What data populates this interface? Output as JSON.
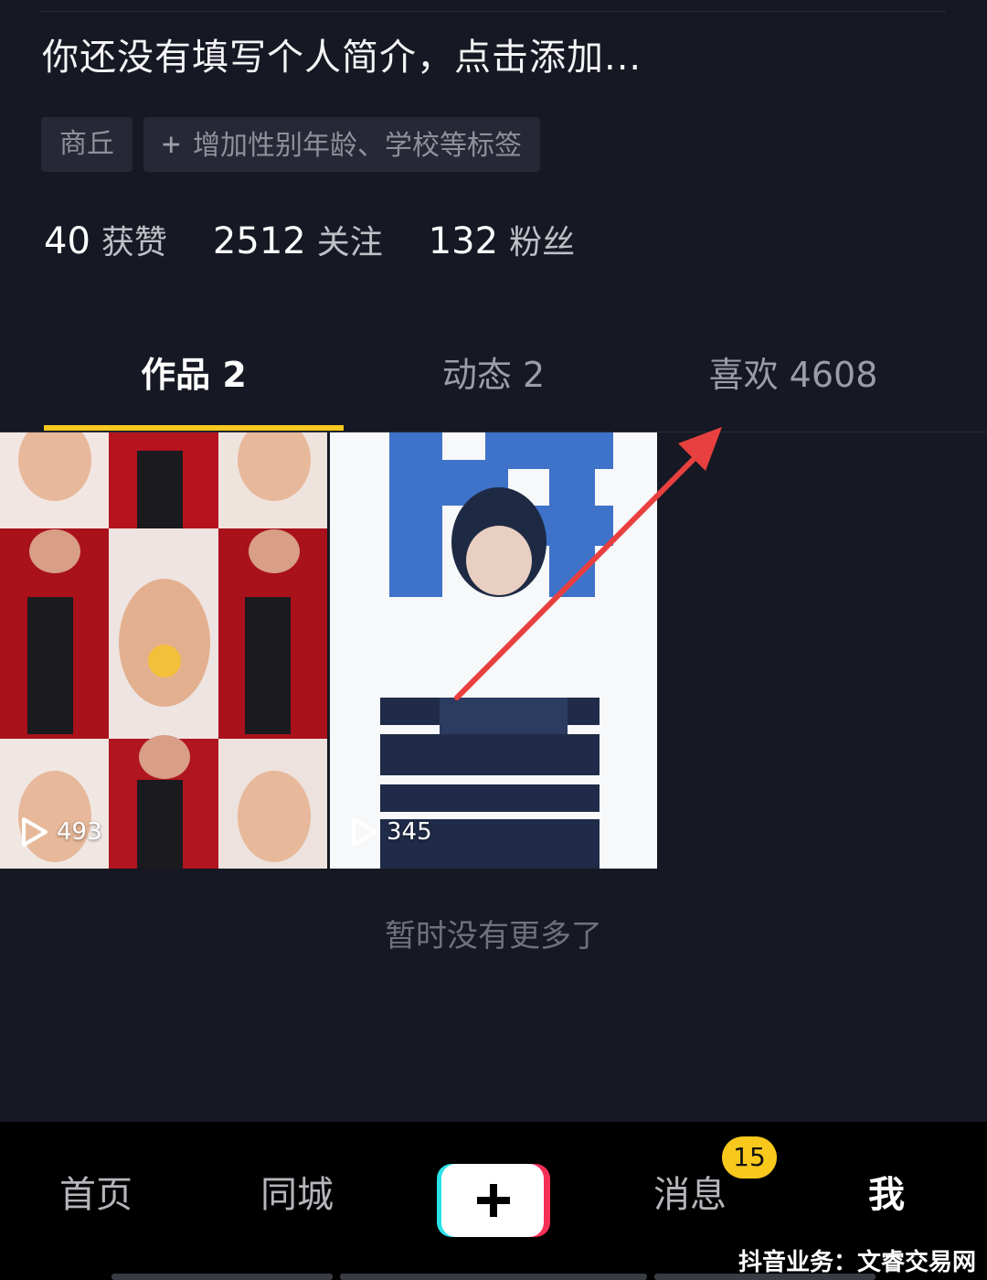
{
  "profile": {
    "bio": "你还没有填写个人简介，点击添加...",
    "tags": [
      {
        "label": "商丘"
      },
      {
        "label": "增加性别年龄、学校等标签"
      }
    ],
    "stats": [
      {
        "value": "40",
        "label": "获赞"
      },
      {
        "value": "2512",
        "label": "关注"
      },
      {
        "value": "132",
        "label": "粉丝"
      }
    ]
  },
  "tabs": [
    {
      "label": "作品 2"
    },
    {
      "label": "动态 2"
    },
    {
      "label": "喜欢 4608"
    }
  ],
  "videos": [
    {
      "plays": "493"
    },
    {
      "plays": "345"
    }
  ],
  "empty_text": "暂时没有更多了",
  "bottom_nav": {
    "items": [
      {
        "label": "首页"
      },
      {
        "label": "同城"
      },
      {
        "label": "消息"
      },
      {
        "label": "我"
      }
    ],
    "messages_badge": "15"
  },
  "watermark": "抖音业务：文睿交易网",
  "colors": {
    "background": "#161823",
    "accent": "#f9c81d",
    "arrow": "#e8403f"
  },
  "icons": {
    "add": "plus-icon",
    "play": "play-icon"
  }
}
